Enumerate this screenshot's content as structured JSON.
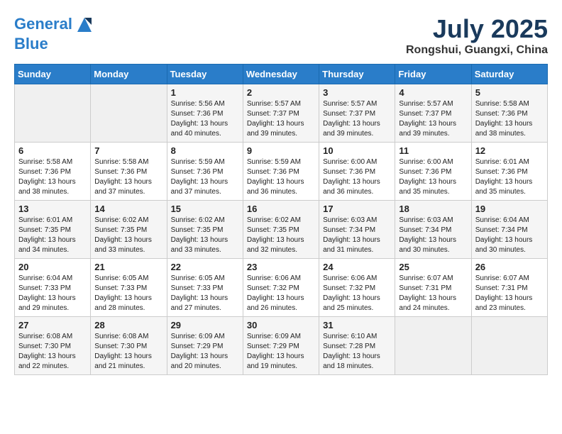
{
  "header": {
    "logo_line1": "General",
    "logo_line2": "Blue",
    "month": "July 2025",
    "location": "Rongshui, Guangxi, China"
  },
  "days_of_week": [
    "Sunday",
    "Monday",
    "Tuesday",
    "Wednesday",
    "Thursday",
    "Friday",
    "Saturday"
  ],
  "weeks": [
    [
      {
        "day": "",
        "sunrise": "",
        "sunset": "",
        "daylight": ""
      },
      {
        "day": "",
        "sunrise": "",
        "sunset": "",
        "daylight": ""
      },
      {
        "day": "1",
        "sunrise": "Sunrise: 5:56 AM",
        "sunset": "Sunset: 7:36 PM",
        "daylight": "Daylight: 13 hours and 40 minutes."
      },
      {
        "day": "2",
        "sunrise": "Sunrise: 5:57 AM",
        "sunset": "Sunset: 7:37 PM",
        "daylight": "Daylight: 13 hours and 39 minutes."
      },
      {
        "day": "3",
        "sunrise": "Sunrise: 5:57 AM",
        "sunset": "Sunset: 7:37 PM",
        "daylight": "Daylight: 13 hours and 39 minutes."
      },
      {
        "day": "4",
        "sunrise": "Sunrise: 5:57 AM",
        "sunset": "Sunset: 7:37 PM",
        "daylight": "Daylight: 13 hours and 39 minutes."
      },
      {
        "day": "5",
        "sunrise": "Sunrise: 5:58 AM",
        "sunset": "Sunset: 7:36 PM",
        "daylight": "Daylight: 13 hours and 38 minutes."
      }
    ],
    [
      {
        "day": "6",
        "sunrise": "Sunrise: 5:58 AM",
        "sunset": "Sunset: 7:36 PM",
        "daylight": "Daylight: 13 hours and 38 minutes."
      },
      {
        "day": "7",
        "sunrise": "Sunrise: 5:58 AM",
        "sunset": "Sunset: 7:36 PM",
        "daylight": "Daylight: 13 hours and 37 minutes."
      },
      {
        "day": "8",
        "sunrise": "Sunrise: 5:59 AM",
        "sunset": "Sunset: 7:36 PM",
        "daylight": "Daylight: 13 hours and 37 minutes."
      },
      {
        "day": "9",
        "sunrise": "Sunrise: 5:59 AM",
        "sunset": "Sunset: 7:36 PM",
        "daylight": "Daylight: 13 hours and 36 minutes."
      },
      {
        "day": "10",
        "sunrise": "Sunrise: 6:00 AM",
        "sunset": "Sunset: 7:36 PM",
        "daylight": "Daylight: 13 hours and 36 minutes."
      },
      {
        "day": "11",
        "sunrise": "Sunrise: 6:00 AM",
        "sunset": "Sunset: 7:36 PM",
        "daylight": "Daylight: 13 hours and 35 minutes."
      },
      {
        "day": "12",
        "sunrise": "Sunrise: 6:01 AM",
        "sunset": "Sunset: 7:36 PM",
        "daylight": "Daylight: 13 hours and 35 minutes."
      }
    ],
    [
      {
        "day": "13",
        "sunrise": "Sunrise: 6:01 AM",
        "sunset": "Sunset: 7:35 PM",
        "daylight": "Daylight: 13 hours and 34 minutes."
      },
      {
        "day": "14",
        "sunrise": "Sunrise: 6:02 AM",
        "sunset": "Sunset: 7:35 PM",
        "daylight": "Daylight: 13 hours and 33 minutes."
      },
      {
        "day": "15",
        "sunrise": "Sunrise: 6:02 AM",
        "sunset": "Sunset: 7:35 PM",
        "daylight": "Daylight: 13 hours and 33 minutes."
      },
      {
        "day": "16",
        "sunrise": "Sunrise: 6:02 AM",
        "sunset": "Sunset: 7:35 PM",
        "daylight": "Daylight: 13 hours and 32 minutes."
      },
      {
        "day": "17",
        "sunrise": "Sunrise: 6:03 AM",
        "sunset": "Sunset: 7:34 PM",
        "daylight": "Daylight: 13 hours and 31 minutes."
      },
      {
        "day": "18",
        "sunrise": "Sunrise: 6:03 AM",
        "sunset": "Sunset: 7:34 PM",
        "daylight": "Daylight: 13 hours and 30 minutes."
      },
      {
        "day": "19",
        "sunrise": "Sunrise: 6:04 AM",
        "sunset": "Sunset: 7:34 PM",
        "daylight": "Daylight: 13 hours and 30 minutes."
      }
    ],
    [
      {
        "day": "20",
        "sunrise": "Sunrise: 6:04 AM",
        "sunset": "Sunset: 7:33 PM",
        "daylight": "Daylight: 13 hours and 29 minutes."
      },
      {
        "day": "21",
        "sunrise": "Sunrise: 6:05 AM",
        "sunset": "Sunset: 7:33 PM",
        "daylight": "Daylight: 13 hours and 28 minutes."
      },
      {
        "day": "22",
        "sunrise": "Sunrise: 6:05 AM",
        "sunset": "Sunset: 7:33 PM",
        "daylight": "Daylight: 13 hours and 27 minutes."
      },
      {
        "day": "23",
        "sunrise": "Sunrise: 6:06 AM",
        "sunset": "Sunset: 7:32 PM",
        "daylight": "Daylight: 13 hours and 26 minutes."
      },
      {
        "day": "24",
        "sunrise": "Sunrise: 6:06 AM",
        "sunset": "Sunset: 7:32 PM",
        "daylight": "Daylight: 13 hours and 25 minutes."
      },
      {
        "day": "25",
        "sunrise": "Sunrise: 6:07 AM",
        "sunset": "Sunset: 7:31 PM",
        "daylight": "Daylight: 13 hours and 24 minutes."
      },
      {
        "day": "26",
        "sunrise": "Sunrise: 6:07 AM",
        "sunset": "Sunset: 7:31 PM",
        "daylight": "Daylight: 13 hours and 23 minutes."
      }
    ],
    [
      {
        "day": "27",
        "sunrise": "Sunrise: 6:08 AM",
        "sunset": "Sunset: 7:30 PM",
        "daylight": "Daylight: 13 hours and 22 minutes."
      },
      {
        "day": "28",
        "sunrise": "Sunrise: 6:08 AM",
        "sunset": "Sunset: 7:30 PM",
        "daylight": "Daylight: 13 hours and 21 minutes."
      },
      {
        "day": "29",
        "sunrise": "Sunrise: 6:09 AM",
        "sunset": "Sunset: 7:29 PM",
        "daylight": "Daylight: 13 hours and 20 minutes."
      },
      {
        "day": "30",
        "sunrise": "Sunrise: 6:09 AM",
        "sunset": "Sunset: 7:29 PM",
        "daylight": "Daylight: 13 hours and 19 minutes."
      },
      {
        "day": "31",
        "sunrise": "Sunrise: 6:10 AM",
        "sunset": "Sunset: 7:28 PM",
        "daylight": "Daylight: 13 hours and 18 minutes."
      },
      {
        "day": "",
        "sunrise": "",
        "sunset": "",
        "daylight": ""
      },
      {
        "day": "",
        "sunrise": "",
        "sunset": "",
        "daylight": ""
      }
    ]
  ]
}
